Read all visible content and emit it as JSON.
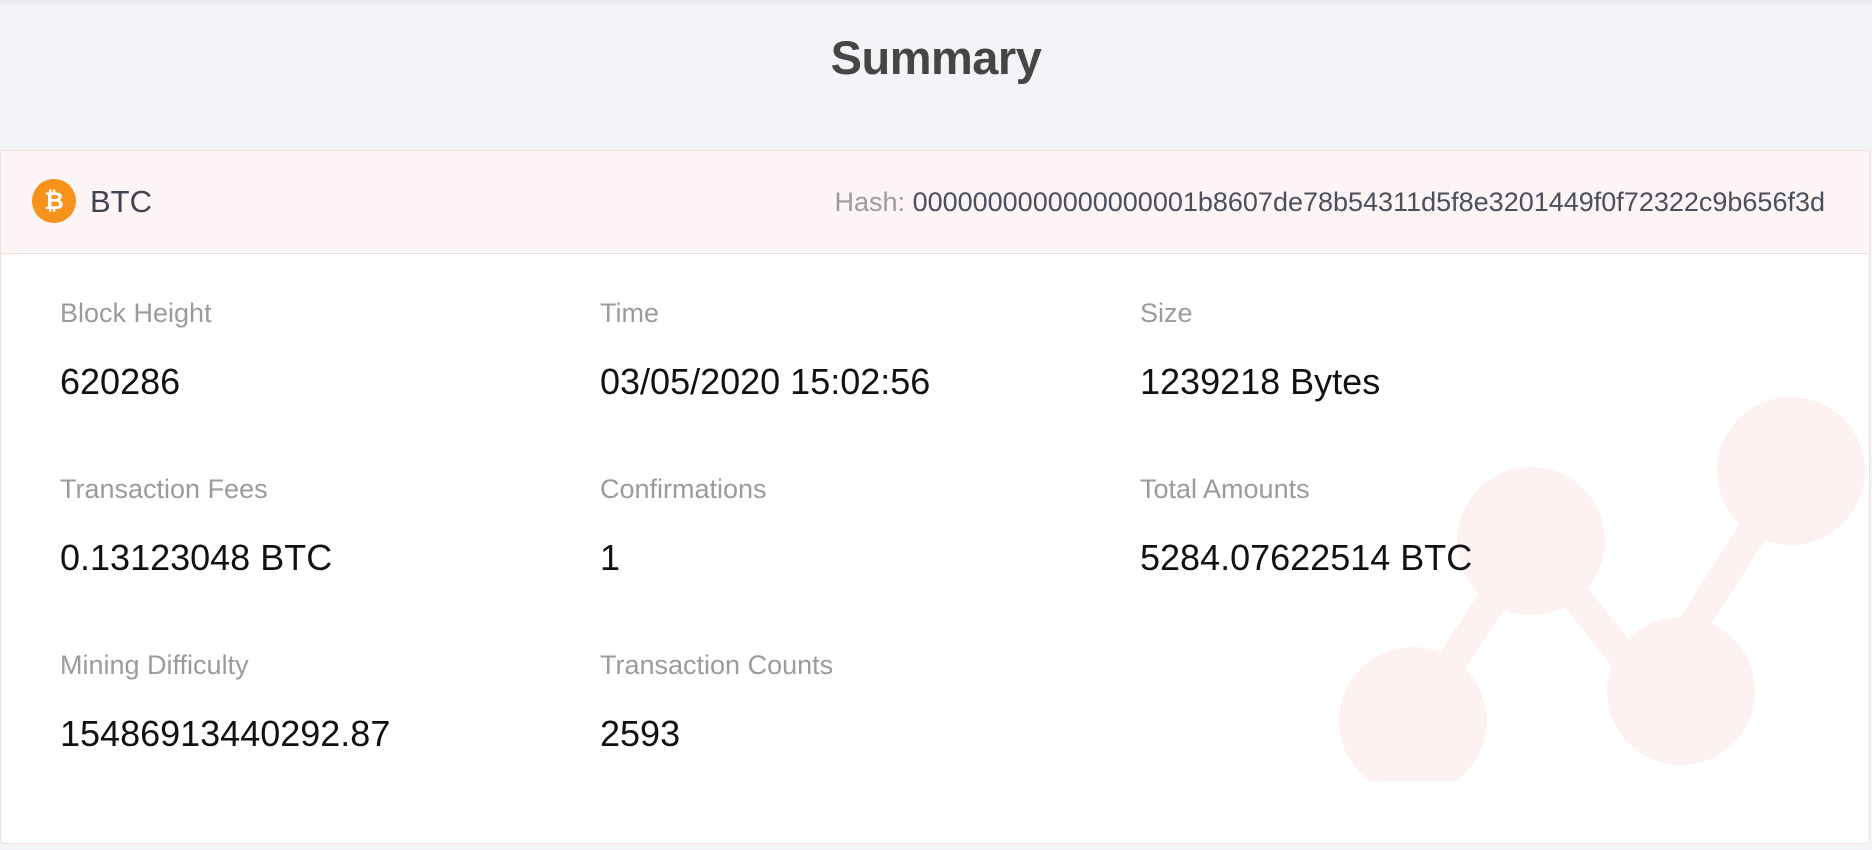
{
  "page": {
    "title": "Summary"
  },
  "block": {
    "coin": {
      "symbol": "BTC",
      "icon": "bitcoin-icon",
      "icon_color": "#f7931a"
    },
    "hash": {
      "label": "Hash:",
      "value": "0000000000000000001b8607de78b54311d5f8e3201449f0f72322c9b656f3d"
    },
    "fields": [
      {
        "label": "Block Height",
        "value": "620286"
      },
      {
        "label": "Time",
        "value": "03/05/2020 15:02:56"
      },
      {
        "label": "Size",
        "value": "1239218 Bytes"
      },
      {
        "label": "Transaction Fees",
        "value": "0.13123048 BTC"
      },
      {
        "label": "Confirmations",
        "value": "1"
      },
      {
        "label": "Total Amounts",
        "value": "5284.07622514 BTC"
      },
      {
        "label": "Mining Difficulty",
        "value": "15486913440292.87"
      },
      {
        "label": "Transaction Counts",
        "value": "2593"
      }
    ],
    "watermark_icon": "chart-nodes-icon",
    "watermark_color": "#fdf1f1"
  }
}
